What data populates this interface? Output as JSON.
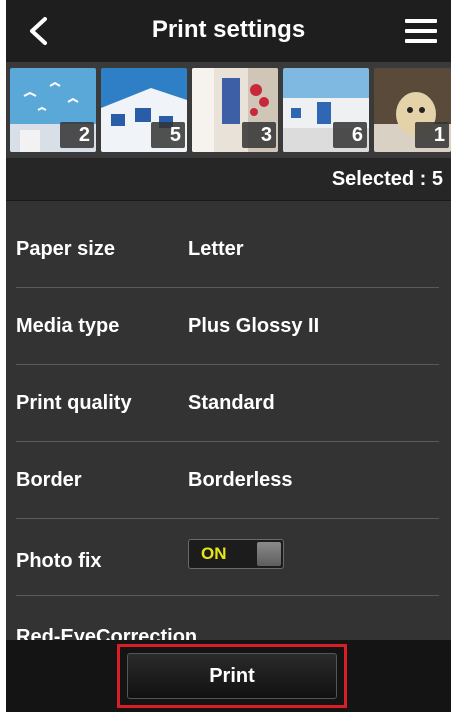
{
  "header": {
    "title": "Print settings",
    "back_icon": "chevron-left-icon",
    "menu_icon": "hamburger-menu-icon"
  },
  "thumbnails": [
    {
      "count": "2"
    },
    {
      "count": "5"
    },
    {
      "count": "3"
    },
    {
      "count": "6"
    },
    {
      "count": "1"
    }
  ],
  "selected": {
    "text": "Selected : 5"
  },
  "settings": {
    "paper_size": {
      "label": "Paper size",
      "value": "Letter"
    },
    "media_type": {
      "label": "Media type",
      "value": "Plus Glossy II"
    },
    "print_quality": {
      "label": "Print quality",
      "value": "Standard"
    },
    "border": {
      "label": "Border",
      "value": "Borderless"
    },
    "photo_fix": {
      "label": "Photo fix",
      "toggle_text": "ON"
    },
    "red_eye": {
      "label": "Red-EyeCorrection"
    }
  },
  "footer": {
    "print_label": "Print",
    "highlight_color": "#d81f26"
  },
  "colors": {
    "toggle_on": "#e6e619",
    "background": "#333333"
  }
}
